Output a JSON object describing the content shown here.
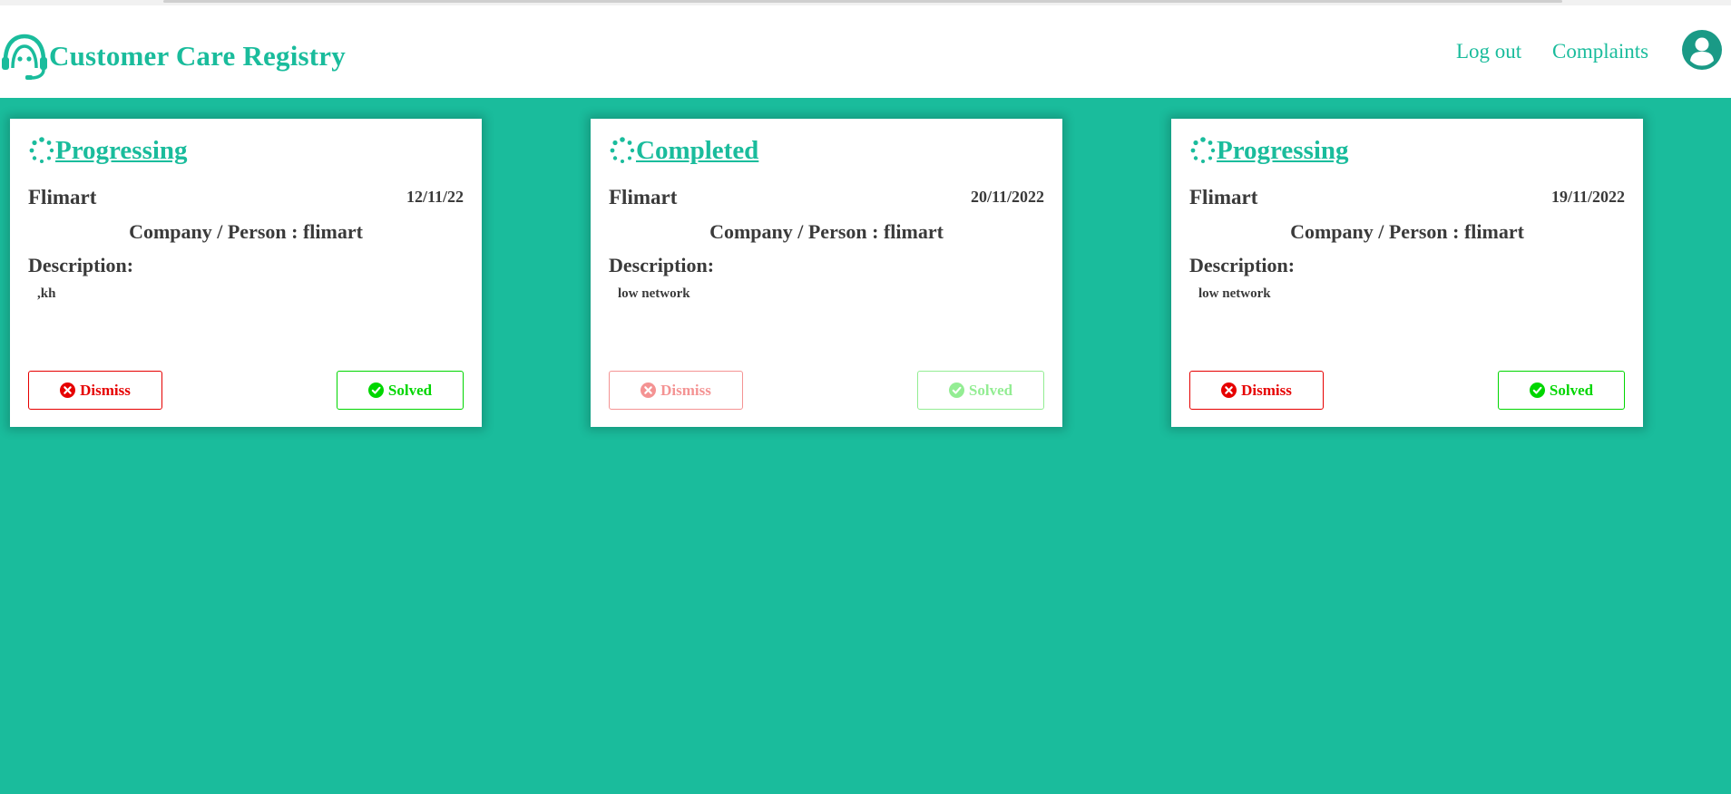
{
  "app": {
    "title": "Customer Care Registry",
    "logo_icon": "headset-agent-icon",
    "accent_color": "#1abc9c"
  },
  "nav": {
    "logout_label": "Log out",
    "complaints_label": "Complaints",
    "profile_icon": "user-circle-icon"
  },
  "complaints": [
    {
      "status": "Progressing",
      "status_icon": "spinner-icon",
      "company": "Flimart",
      "date": "12/11/22",
      "person_line": "Company / Person : flimart",
      "description_label": "Description:",
      "description": ",kh",
      "dismiss_label": "Dismiss",
      "solved_label": "Solved",
      "actions_enabled": true
    },
    {
      "status": "Completed",
      "status_icon": "spinner-icon",
      "company": "Flimart",
      "date": "20/11/2022",
      "person_line": "Company / Person : flimart",
      "description_label": "Description:",
      "description": "low network",
      "dismiss_label": "Dismiss",
      "solved_label": "Solved",
      "actions_enabled": false
    },
    {
      "status": "Progressing",
      "status_icon": "spinner-icon",
      "company": "Flimart",
      "date": "19/11/2022",
      "person_line": "Company / Person : flimart",
      "description_label": "Description:",
      "description": "low network",
      "dismiss_label": "Dismiss",
      "solved_label": "Solved",
      "actions_enabled": true
    }
  ],
  "colors": {
    "page_background": "#1abc9c",
    "dismiss": "#e60000",
    "solved": "#00d600",
    "text": "#3a3a3a"
  }
}
